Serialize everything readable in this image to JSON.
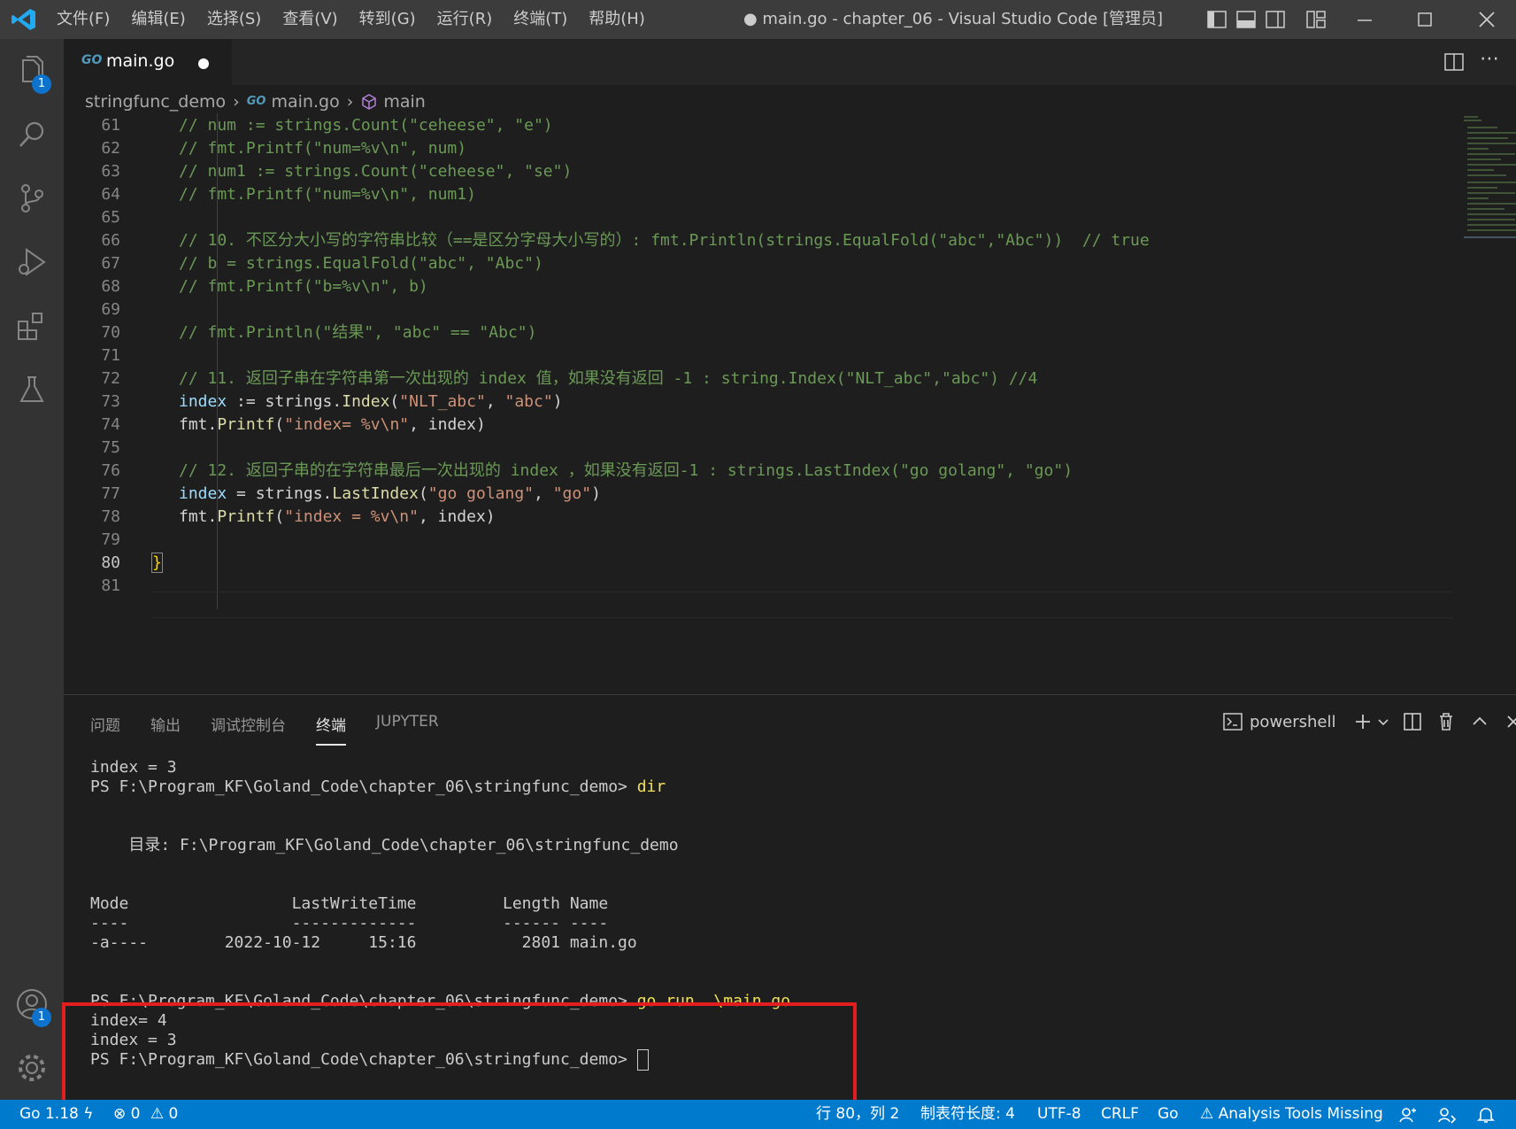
{
  "colors": {
    "titlebar": "#3c3c3c",
    "activitybar": "#333333",
    "editor": "#1e1e1e",
    "statusbar": "#007acc",
    "highlight": "#e41e1e",
    "badge": "#0e73cc"
  },
  "menu": [
    "文件(F)",
    "编辑(E)",
    "选择(S)",
    "查看(V)",
    "转到(G)",
    "运行(R)",
    "终端(T)",
    "帮助(H)"
  ],
  "window_title": "● main.go - chapter_06 - Visual Studio Code [管理员]",
  "activity": {
    "explorer_badge": "1",
    "accounts_badge": "1"
  },
  "tab": {
    "icon_text": "GO",
    "label": "main.go"
  },
  "breadcrumb": {
    "folder": "stringfunc_demo",
    "file": "main.go",
    "symbol": "main",
    "file_icon": "GO"
  },
  "code_lines": [
    {
      "n": "61",
      "parts": [
        [
          "cmt",
          "// num := strings.Count(\"ceheese\", \"e\")"
        ]
      ]
    },
    {
      "n": "62",
      "parts": [
        [
          "cmt",
          "// fmt.Printf(\"num=%v\\n\", num)"
        ]
      ]
    },
    {
      "n": "63",
      "parts": [
        [
          "cmt",
          "// num1 := strings.Count(\"ceheese\", \"se\")"
        ]
      ]
    },
    {
      "n": "64",
      "parts": [
        [
          "cmt",
          "// fmt.Printf(\"num=%v\\n\", num1)"
        ]
      ]
    },
    {
      "n": "65",
      "parts": []
    },
    {
      "n": "66",
      "parts": [
        [
          "cmt",
          "// 10. 不区分大小写的字符串比较（==是区分字母大小写的）: fmt.Println(strings.EqualFold(\"abc\",\"Abc\"))  // true"
        ]
      ]
    },
    {
      "n": "67",
      "parts": [
        [
          "cmt",
          "// b = strings.EqualFold(\"abc\", \"Abc\")"
        ]
      ]
    },
    {
      "n": "68",
      "parts": [
        [
          "cmt",
          "// fmt.Printf(\"b=%v\\n\", b)"
        ]
      ]
    },
    {
      "n": "69",
      "parts": []
    },
    {
      "n": "70",
      "parts": [
        [
          "cmt",
          "// fmt.Println(\"结果\", \"abc\" == \"Abc\")"
        ]
      ]
    },
    {
      "n": "71",
      "parts": []
    },
    {
      "n": "72",
      "parts": [
        [
          "cmt",
          "// 11. 返回子串在字符串第一次出现的 index 值，如果没有返回 -1 : string.Index(\"NLT_abc\",\"abc\") //4"
        ]
      ]
    },
    {
      "n": "73",
      "parts": [
        [
          "kw",
          "index"
        ],
        [
          "plain",
          " := strings."
        ],
        [
          "fn",
          "Index"
        ],
        [
          "plain",
          "("
        ],
        [
          "str",
          "\"NLT_abc\""
        ],
        [
          "plain",
          ", "
        ],
        [
          "str",
          "\"abc\""
        ],
        [
          "plain",
          ")"
        ]
      ]
    },
    {
      "n": "74",
      "parts": [
        [
          "plain",
          "fmt."
        ],
        [
          "fn",
          "Printf"
        ],
        [
          "plain",
          "("
        ],
        [
          "str",
          "\"index= %v\\n\""
        ],
        [
          "plain",
          ", index)"
        ]
      ]
    },
    {
      "n": "75",
      "parts": []
    },
    {
      "n": "76",
      "parts": [
        [
          "cmt",
          "// 12. 返回子串的在字符串最后一次出现的 index ，如果没有返回-1 : strings.LastIndex(\"go golang\", \"go\")"
        ]
      ]
    },
    {
      "n": "77",
      "parts": [
        [
          "kw",
          "index"
        ],
        [
          "plain",
          " = strings."
        ],
        [
          "fn",
          "LastIndex"
        ],
        [
          "plain",
          "("
        ],
        [
          "str",
          "\"go golang\""
        ],
        [
          "plain",
          ", "
        ],
        [
          "str",
          "\"go\""
        ],
        [
          "plain",
          ")"
        ]
      ]
    },
    {
      "n": "78",
      "parts": [
        [
          "plain",
          "fmt."
        ],
        [
          "fn",
          "Printf"
        ],
        [
          "plain",
          "("
        ],
        [
          "str",
          "\"index = %v\\n\""
        ],
        [
          "plain",
          ", index)"
        ]
      ]
    },
    {
      "n": "79",
      "parts": []
    },
    {
      "n": "80",
      "parts": [
        [
          "brace",
          "}"
        ]
      ]
    },
    {
      "n": "81",
      "parts": []
    }
  ],
  "panel": {
    "tabs": [
      "问题",
      "输出",
      "调试控制台",
      "终端",
      "JUPYTER"
    ],
    "active_tab": "终端",
    "terminal_name": "powershell"
  },
  "terminal_lines": [
    {
      "t": "index = 3"
    },
    {
      "t": "PS F:\\Program_KF\\Goland_Code\\chapter_06\\stringfunc_demo> ",
      "cmd": "dir"
    },
    {
      "t": ""
    },
    {
      "t": ""
    },
    {
      "t": "    目录: F:\\Program_KF\\Goland_Code\\chapter_06\\stringfunc_demo"
    },
    {
      "t": ""
    },
    {
      "t": ""
    },
    {
      "t": "Mode                 LastWriteTime         Length Name"
    },
    {
      "t": "----                 -------------         ------ ----"
    },
    {
      "t": "-a----        2022-10-12     15:16           2801 main.go"
    },
    {
      "t": ""
    },
    {
      "t": ""
    },
    {
      "t": "PS F:\\Program_KF\\Goland_Code\\chapter_06\\stringfunc_demo> ",
      "cmd": "go run .\\main.go"
    },
    {
      "t": "index= 4"
    },
    {
      "t": "index = 3"
    },
    {
      "t": "PS F:\\Program_KF\\Goland_Code\\chapter_06\\stringfunc_demo> ",
      "cursor": true
    }
  ],
  "status": {
    "go_version": "Go 1.18",
    "errors": "0",
    "warnings": "0",
    "position": "行 80，列 2",
    "tab_size": "制表符长度: 4",
    "encoding": "UTF-8",
    "eol": "CRLF",
    "language": "Go",
    "analysis": "Analysis Tools Missing"
  }
}
